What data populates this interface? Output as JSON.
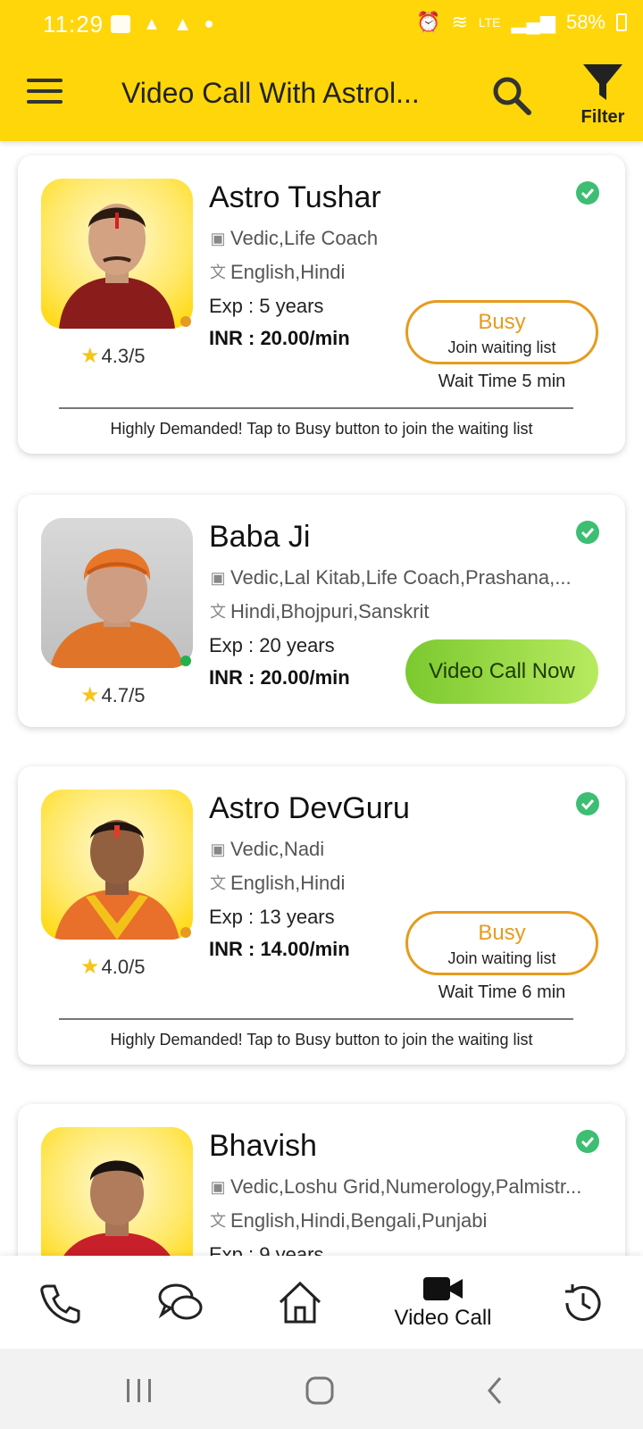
{
  "status_bar": {
    "time": "11:29",
    "battery": "58%"
  },
  "app_bar": {
    "title": "Video Call With Astrol...",
    "filter_label": "Filter"
  },
  "cards": [
    {
      "name": "Astro Tushar",
      "skills": "Vedic,Life Coach",
      "languages": "English,Hindi",
      "experience": "Exp : 5 years",
      "price": "INR : 20.00/min",
      "rating": "4.3/5",
      "status": "busy",
      "busy_label": "Busy",
      "busy_sub": "Join waiting list",
      "wait_time": "Wait Time 5 min",
      "notice": "Highly Demanded! Tap to Busy button to join the waiting list"
    },
    {
      "name": "Baba Ji",
      "skills": "Vedic,Lal Kitab,Life Coach,Prashana,...",
      "languages": "Hindi,Bhojpuri,Sanskrit",
      "experience": "Exp : 20 years",
      "price": "INR : 20.00/min",
      "rating": "4.7/5",
      "status": "online",
      "call_label": "Video Call Now"
    },
    {
      "name": "Astro DevGuru",
      "skills": "Vedic,Nadi",
      "languages": "English,Hindi",
      "experience": "Exp : 13 years",
      "price": "INR : 14.00/min",
      "rating": "4.0/5",
      "status": "busy",
      "busy_label": "Busy",
      "busy_sub": "Join waiting list",
      "wait_time": "Wait Time 6 min",
      "notice": "Highly Demanded! Tap to Busy button to join the waiting list"
    },
    {
      "name": "Bhavish",
      "skills": "Vedic,Loshu Grid,Numerology,Palmistr...",
      "languages": "English,Hindi,Bengali,Punjabi",
      "experience": "Exp : 9 years"
    }
  ],
  "bottom_nav": {
    "active_label": "Video Call",
    "items": [
      "call-icon",
      "chat-icon",
      "home-icon",
      "video-call-icon",
      "history-icon"
    ]
  },
  "colors": {
    "brand_yellow": "#FFD60A",
    "busy_orange": "#E69B1E",
    "online_green": "#22B14C",
    "verified_green": "#3DBE73"
  }
}
